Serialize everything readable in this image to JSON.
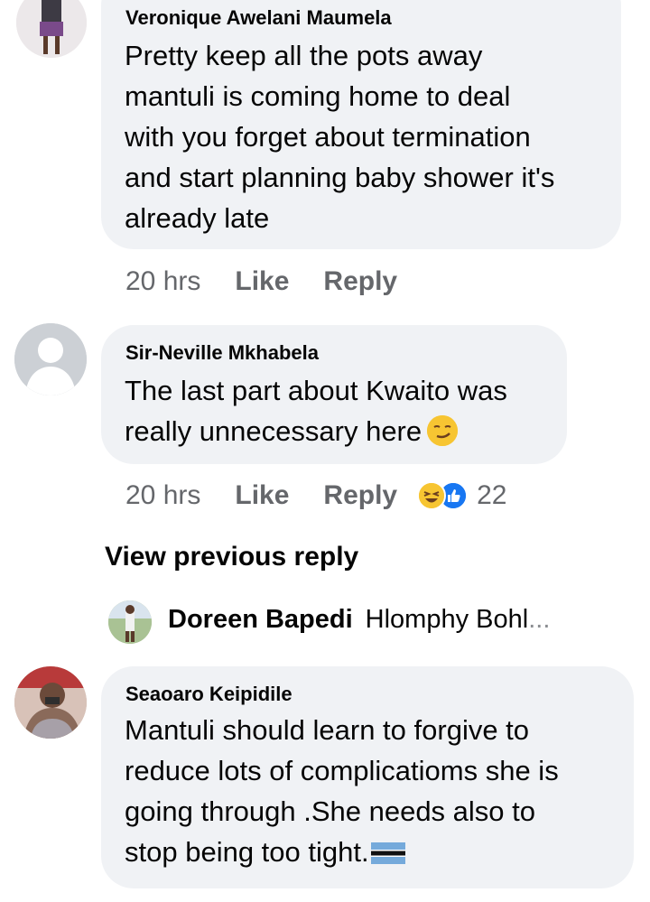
{
  "comments": [
    {
      "author": "Veronique Awelani Maumela",
      "text": "Pretty keep all the pots away\nmantuli is coming  home to deal\nwith you forget about termination\nand start planning baby shower it's\nalready late",
      "time": "20 hrs",
      "like": "Like",
      "reply": "Reply"
    },
    {
      "author": "Sir-Neville Mkhabela",
      "text": "The last part about Kwaito was\nreally unnecessary here",
      "emoji": "smirking-face",
      "time": "20 hrs",
      "like": "Like",
      "reply": "Reply",
      "reactions": {
        "icons": [
          "haha-icon",
          "like-icon"
        ],
        "count": "22"
      }
    },
    {
      "author": "Seaoaro Keipidile",
      "text": "Mantuli should learn to forgive to\nreduce lots of complicatioms she is\ngoing through .She needs also to\nstop being too tight.",
      "emoji": "botswana-flag"
    }
  ],
  "view_previous": "View previous reply",
  "reply_preview": {
    "author": "Doreen Bapedi",
    "text": "Hlomphy Bohl",
    "ellipsis": "..."
  },
  "colors": {
    "bubble": "#f0f2f5",
    "meta": "#65676b",
    "like_blue": "#1877f2",
    "haha_yellow": "#f7c532"
  }
}
